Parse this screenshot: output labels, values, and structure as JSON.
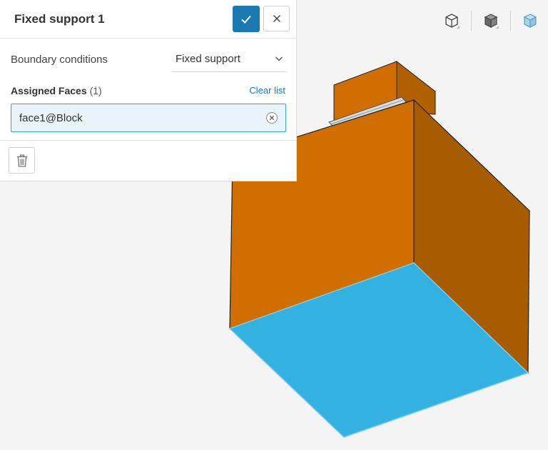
{
  "panel": {
    "title": "Fixed support 1",
    "confirm_icon": "check-icon",
    "close_icon": "close-icon",
    "boundary_conditions_label": "Boundary conditions",
    "boundary_conditions_value": "Fixed support",
    "assigned_faces_label": "Assigned Faces",
    "assigned_faces_count": "(1)",
    "clear_list_label": "Clear list",
    "faces": [
      {
        "label": "face1@Block"
      }
    ],
    "delete_icon": "trash-icon"
  },
  "view_toolbar": {
    "items": [
      {
        "icon": "wireframe-cube-icon"
      },
      {
        "icon": "solid-cube-icon"
      },
      {
        "icon": "transparent-cube-icon"
      }
    ]
  },
  "colors": {
    "accent": "#1a79b0",
    "model_face": "#d06e00",
    "model_side": "#a85c00",
    "selected_face": "#33b1e0",
    "selected_border": "#3aa0d0"
  }
}
